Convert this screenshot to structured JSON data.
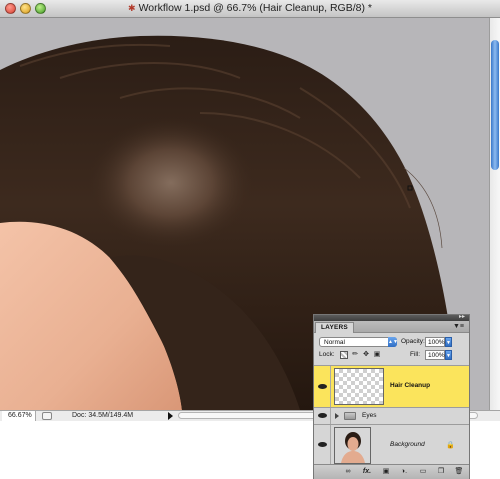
{
  "window": {
    "title": "Workflow 1.psd @ 66.7% (Hair Cleanup, RGB/8) *",
    "title_icon": "document-modified-icon"
  },
  "statusbar": {
    "zoom": "66.67%",
    "doc_size": "Doc: 34.5M/149.4M"
  },
  "layers_panel": {
    "tab_label": "LAYERS",
    "blend_mode": "Normal",
    "opacity_label": "Opacity:",
    "opacity_value": "100%",
    "lock_label": "Lock:",
    "fill_label": "Fill:",
    "fill_value": "100%",
    "layers": [
      {
        "name": "Hair Cleanup",
        "selected": true,
        "visible": true,
        "type": "pixel"
      },
      {
        "name": "Eyes",
        "selected": false,
        "visible": true,
        "type": "group"
      },
      {
        "name": "Background",
        "selected": false,
        "visible": true,
        "type": "background",
        "locked": true
      }
    ],
    "bottom_icons": [
      "link-layers-icon",
      "fx-icon",
      "add-mask-icon",
      "adjustment-layer-icon",
      "new-group-icon",
      "new-layer-icon",
      "delete-layer-icon"
    ]
  },
  "colors": {
    "selected_layer": "#fbe45c",
    "scroll_thumb": "#3a78c9",
    "canvas_bg": "#b7b6b9"
  }
}
